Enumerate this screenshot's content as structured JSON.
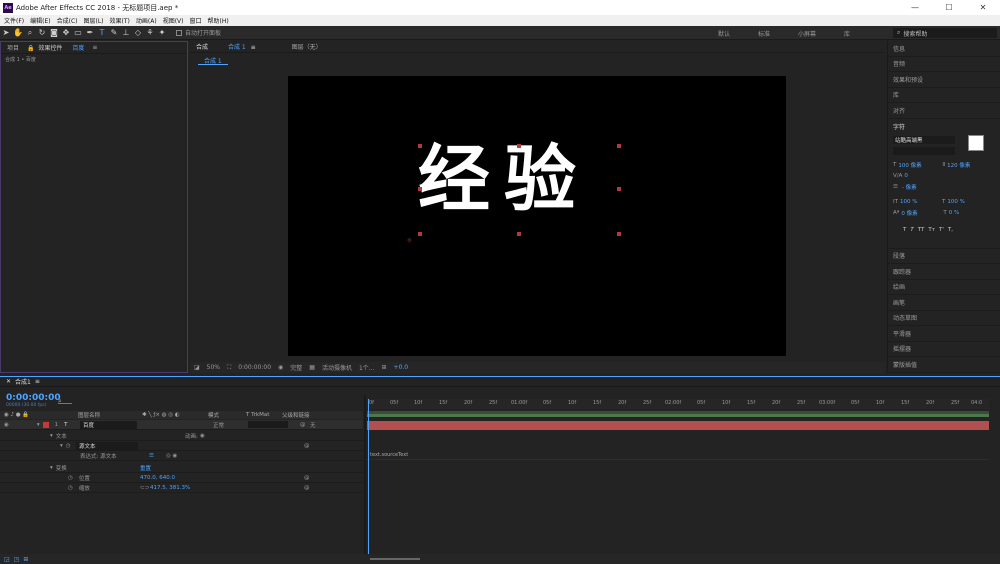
{
  "titlebar": {
    "title": "Adobe After Effects CC 2018 - 无标题项目.aep *",
    "logo": "Ae",
    "minimize": "—",
    "maximize": "☐",
    "close": "✕"
  },
  "menu": [
    "文件(F)",
    "编辑(E)",
    "合成(C)",
    "图层(L)",
    "效果(T)",
    "动画(A)",
    "视图(V)",
    "窗口",
    "帮助(H)"
  ],
  "toolbar": {
    "auto_open": "自动打开面板",
    "workspaces": [
      "默认",
      "标准",
      "小屏幕",
      "库"
    ],
    "search_help": "搜索帮助"
  },
  "left_panel": {
    "tab_project": "项目",
    "tab_effects_prefix": "效果控件",
    "tab_effects_layer": "百度",
    "breadcrumb": "合成 1 • 百度"
  },
  "center_panel": {
    "tab_comp_prefix": "合成",
    "tab_comp_name": "合成 1",
    "tab_layer": "图层（无）",
    "comp_chip": "合成 1",
    "canvas_text": "经验",
    "viewbar": {
      "zoom": "50%",
      "timecode": "0:00:00:00",
      "quality": "完整",
      "camera": "活动摄像机",
      "views": "1个...",
      "exposure": "+0.0"
    }
  },
  "right_panel": {
    "top_items": [
      "信息",
      "音频",
      "效果和预设",
      "库",
      "对齐"
    ],
    "character": {
      "title": "字符",
      "font": "站酷高端黑",
      "font_size": "100 像素",
      "leading": "120 像素",
      "kerning": "0",
      "tracking_unit": "- 像素",
      "vscale": "100 %",
      "hscale": "100 %",
      "baseline": "0 像素",
      "tsume": "0 %",
      "styles": [
        "T",
        "T",
        "TT",
        "Tт",
        "T'",
        "T,"
      ]
    },
    "bottom_items": [
      "段落",
      "跟踪器",
      "绘画",
      "画笔",
      "动态草图",
      "平滑器",
      "摇摆器",
      "蒙版插值"
    ]
  },
  "timeline": {
    "tab": "合成1",
    "timecode": "0:00:00:00",
    "timecode_sub": "00000 (30.00 fps)",
    "columns": {
      "name": "图层名称",
      "mode": "模式",
      "trkmat": "T TrkMat",
      "parent": "父级和链接"
    },
    "layer": {
      "index": "1",
      "name": "百度",
      "mode": "正常",
      "parent": "无"
    },
    "props": {
      "text": "文本",
      "animate": "动画:",
      "source_text": "源文本",
      "expression_label": "表达式: 源文本",
      "transform": "变换",
      "reset": "重置",
      "position": "位置",
      "position_value": "470.0, 640.0",
      "scale": "缩放",
      "scale_value": "417.5, 381.3%",
      "expression_code": "text.sourceText"
    },
    "ruler_labels": [
      "0f",
      "05f",
      "10f",
      "15f",
      "20f",
      "25f",
      "01:00f",
      "05f",
      "10f",
      "15f",
      "20f",
      "25f",
      "02:00f",
      "05f",
      "10f",
      "15f",
      "20f",
      "25f",
      "03:00f",
      "05f",
      "10f",
      "15f",
      "20f",
      "25f",
      "04:0"
    ]
  }
}
